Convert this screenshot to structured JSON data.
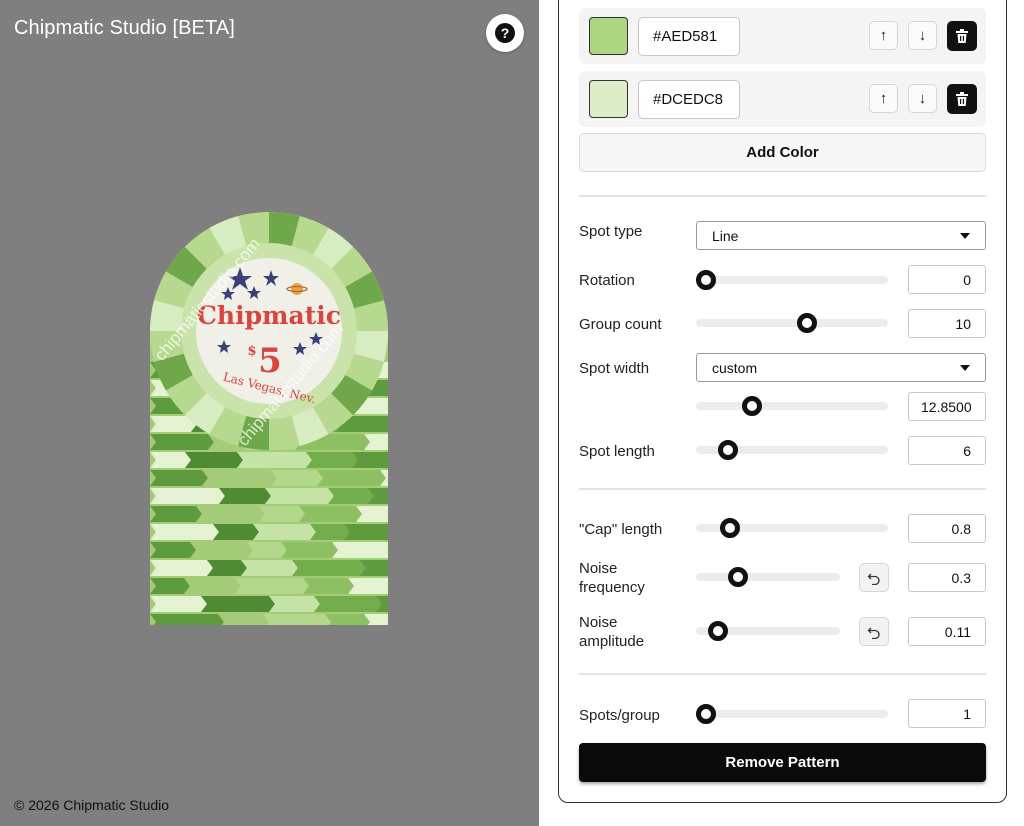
{
  "app": {
    "title": "Chipmatic Studio [BETA]",
    "help_label": "?",
    "footer": "© 2026 Chipmatic Studio"
  },
  "chip": {
    "brand": "Chipmatic",
    "currency_symbol": "$",
    "denomination": "5",
    "location": "Las Vegas, Nev.",
    "watermark": "chipmaticstudio.com"
  },
  "colors": [
    {
      "hex": "#AED581",
      "swatch": "#AED581"
    },
    {
      "hex": "#DCEDC8",
      "swatch": "#DCEDC8"
    }
  ],
  "icons": {
    "up": "arrow-up-icon",
    "down": "arrow-down-icon",
    "delete": "trash-icon",
    "reset": "undo-icon"
  },
  "add_color_label": "Add Color",
  "controls": {
    "spot_type": {
      "label": "Spot type",
      "value": "Line"
    },
    "rotation": {
      "label": "Rotation",
      "value": "0",
      "fraction": 0.0
    },
    "group_count": {
      "label": "Group count",
      "value": "10",
      "fraction": 0.59
    },
    "spot_width": {
      "label": "Spot width",
      "select_value": "custom",
      "value": "12.8500",
      "fraction": 0.27
    },
    "spot_length": {
      "label": "Spot length",
      "value": "6",
      "fraction": 0.13
    },
    "cap_length": {
      "label": "\"Cap\" length",
      "value": "0.8",
      "fraction": 0.14
    },
    "noise_frequency": {
      "label_line1": "Noise",
      "label_line2": "frequency",
      "value": "0.3",
      "fraction": 0.26
    },
    "noise_amplitude": {
      "label_line1": "Noise",
      "label_line2": "amplitude",
      "value": "0.11",
      "fraction": 0.1
    },
    "spots_per_group": {
      "label": "Spots/group",
      "value": "1",
      "fraction": 0.0
    }
  },
  "remove_pattern_label": "Remove Pattern"
}
